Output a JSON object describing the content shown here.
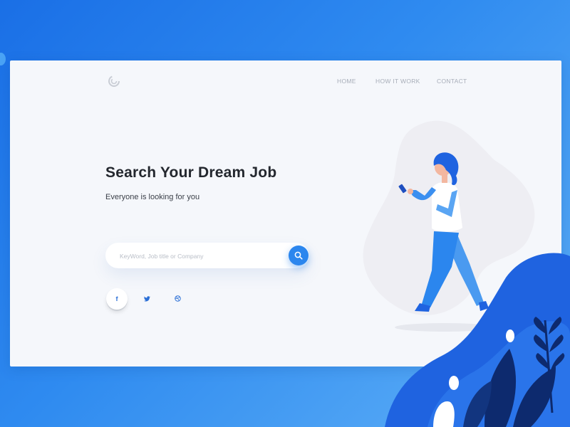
{
  "nav": {
    "items": [
      {
        "label": "HOME"
      },
      {
        "label": "HOW IT WORK"
      },
      {
        "label": "CONTACT"
      }
    ]
  },
  "hero": {
    "title": "Search Your Dream Job",
    "subtitle": "Everyone is looking for you"
  },
  "search": {
    "placeholder": "KeyWord, Job title or Company",
    "value": ""
  },
  "social": {
    "facebook": "f",
    "twitter_icon": "twitter-bird",
    "dribbble_icon": "dribbble-ball"
  },
  "colors": {
    "accent": "#2b86ee",
    "background_gradient_start": "#1a6fe6",
    "background_gradient_end": "#5fb0f6",
    "card": "#f5f7fb",
    "headline": "#23272e",
    "nav_text": "#a7adb8",
    "foliage_dark": "#0d2a6e",
    "foliage_mid": "#1f63e0"
  }
}
